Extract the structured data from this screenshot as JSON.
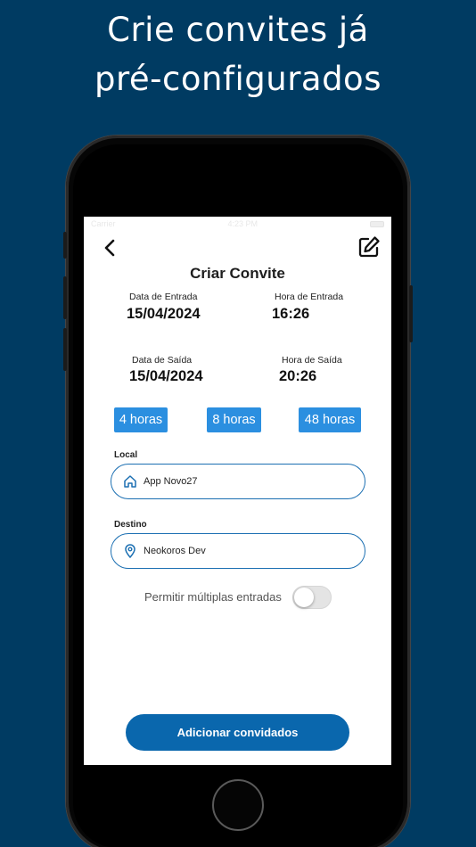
{
  "headline": {
    "line1": "Crie convites já",
    "line2": "pré-configurados"
  },
  "statusbar": {
    "carrier": "Carrier",
    "time": "4:23 PM"
  },
  "screen": {
    "title": "Criar Convite",
    "back_icon": "chevron-left-icon",
    "edit_icon": "edit-square-icon",
    "entrada": {
      "date_label": "Data de Entrada",
      "date_value": "15/04/2024",
      "time_label": "Hora de Entrada",
      "time_value": "16:26"
    },
    "saida": {
      "date_label": "Data de Saída",
      "date_value": "15/04/2024",
      "time_label": "Hora de Saída",
      "time_value": "20:26"
    },
    "quick_durations": [
      "4 horas",
      "8 horas",
      "48 horas"
    ],
    "local": {
      "label": "Local",
      "value": "App Novo27",
      "icon": "home-icon"
    },
    "destino": {
      "label": "Destino",
      "value": "Neokoros Dev",
      "icon": "map-pin-icon"
    },
    "multiple_entries": {
      "label": "Permitir múltiplas entradas",
      "enabled": false
    },
    "primary_button": "Adicionar convidados"
  },
  "colors": {
    "background": "#003b62",
    "accent": "#2b8fe0",
    "primary": "#0a67ad",
    "input_border": "#1b6fb2"
  }
}
